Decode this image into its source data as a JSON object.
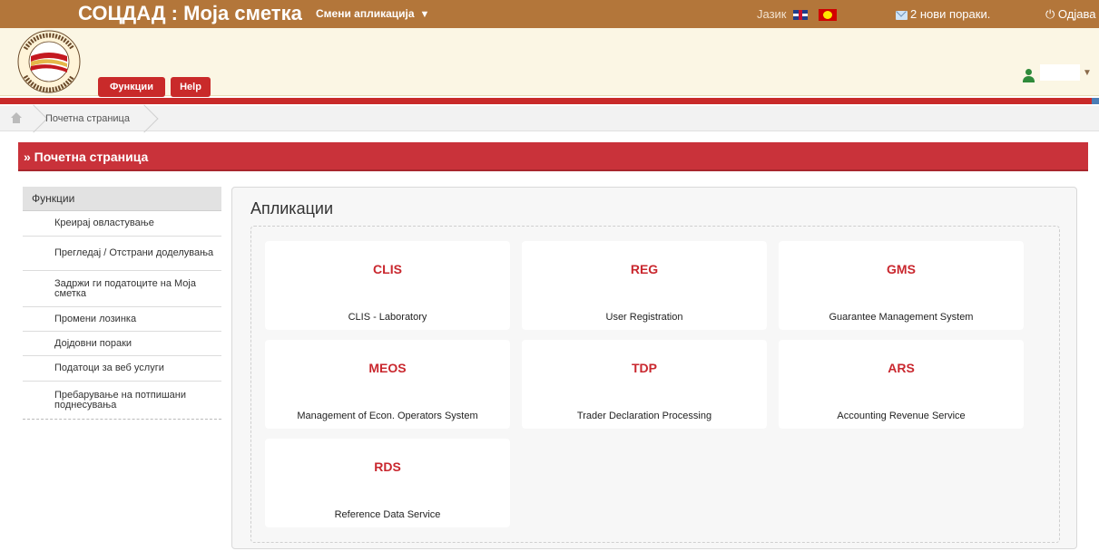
{
  "topbar": {
    "app_title": "СОЦДАД : Моја сметка",
    "switch_app": "Смени апликација",
    "language_label": "Јазик",
    "messages": "2 нови пораки.",
    "logout": "Одјава"
  },
  "header": {
    "logo_text_top": "РЕПУБЛИКА СЕВЕРНА МАКЕДОНИЈА",
    "logo_text_mid": "ЦАРИНСКА УПРАВА",
    "logo_text_bottom": "ЦАРИНА • CUSTOMS",
    "btn_functions": "Функции",
    "btn_help": "Help"
  },
  "breadcrumb": {
    "current": "Почетна страница"
  },
  "section_title": "» Почетна страница",
  "sidebar": {
    "header": "Функции",
    "items": [
      {
        "label": "Креирај овластување"
      },
      {
        "label": "Прегледај / Отстрани доделувања"
      },
      {
        "label": "Задржи ги податоците на Моја сметка"
      },
      {
        "label": "Промени лозинка"
      },
      {
        "label": "Дојдовни пораки"
      },
      {
        "label": "Податоци за веб услуги"
      },
      {
        "label": "Пребарување на потпишани поднесувања"
      }
    ]
  },
  "apps": {
    "title": "Апликации",
    "items": [
      {
        "code": "CLIS",
        "name": "CLIS - Laboratory"
      },
      {
        "code": "REG",
        "name": "User Registration"
      },
      {
        "code": "GMS",
        "name": "Guarantee Management System"
      },
      {
        "code": "MEOS",
        "name": "Management of Econ. Operators System"
      },
      {
        "code": "TDP",
        "name": "Trader Declaration Processing"
      },
      {
        "code": "ARS",
        "name": "Accounting Revenue Service"
      },
      {
        "code": "RDS",
        "name": "Reference Data Service"
      }
    ]
  },
  "colors": {
    "topbar": "#b3763a",
    "accent_red": "#c9323a",
    "header_bg": "#fbf6e4",
    "app_code": "#c9272e"
  },
  "icons": [
    "home-icon",
    "mail-icon",
    "power-icon",
    "user-icon",
    "caret-down-icon",
    "flag-uk-icon",
    "flag-mk-icon"
  ]
}
